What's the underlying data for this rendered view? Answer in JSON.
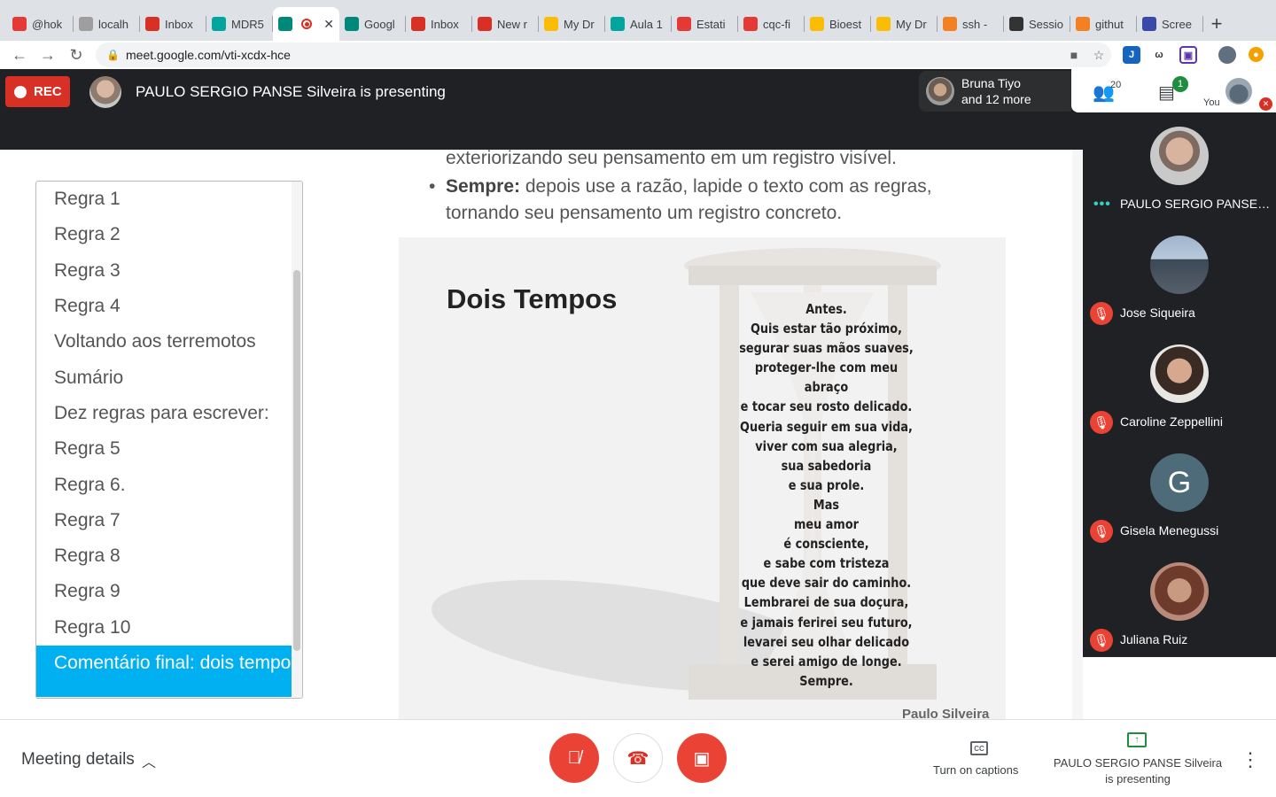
{
  "browser": {
    "tabs": [
      {
        "label": "@hok",
        "icon": "red-square-icon",
        "color": "#e53935",
        "active": false
      },
      {
        "label": "localh",
        "icon": "globe-icon",
        "color": "#9e9e9e",
        "active": false
      },
      {
        "label": "Inbox",
        "icon": "gmail-icon",
        "color": "#d93025",
        "active": false
      },
      {
        "label": "MDR5",
        "icon": "classroom-icon",
        "color": "#00a5a0",
        "active": false
      },
      {
        "label": "",
        "icon": "meet-icon",
        "color": "#00897b",
        "active": true
      },
      {
        "label": "Googl",
        "icon": "meet-icon",
        "color": "#00897b",
        "active": false
      },
      {
        "label": "Inbox",
        "icon": "gmail-icon",
        "color": "#d93025",
        "active": false
      },
      {
        "label": "New r",
        "icon": "gmail-icon",
        "color": "#d93025",
        "active": false
      },
      {
        "label": "My Dr",
        "icon": "drive-icon",
        "color": "#fbbc04",
        "active": false
      },
      {
        "label": "Aula 1",
        "icon": "classroom-icon",
        "color": "#00a5a0",
        "active": false
      },
      {
        "label": "Estati",
        "icon": "pdf-icon",
        "color": "#e53935",
        "active": false
      },
      {
        "label": "cqc-fi",
        "icon": "clapper-icon",
        "color": "#e53935",
        "active": false
      },
      {
        "label": "Bioest",
        "icon": "drive-icon",
        "color": "#fbbc04",
        "active": false
      },
      {
        "label": "My Dr",
        "icon": "drive-icon",
        "color": "#fbbc04",
        "active": false
      },
      {
        "label": "ssh -",
        "icon": "stack-icon",
        "color": "#f48024",
        "active": false
      },
      {
        "label": "Sessio",
        "icon": "github-icon",
        "color": "#333333",
        "active": false
      },
      {
        "label": "githut",
        "icon": "stack-icon",
        "color": "#f48024",
        "active": false
      },
      {
        "label": "Scree",
        "icon": "screen-icon",
        "color": "#3949ab",
        "active": false
      }
    ],
    "new_tab": "+",
    "url": "meet.google.com/vti-xcdx-hce"
  },
  "meet": {
    "rec_label": "REC",
    "presenting_title": "PAULO SERGIO PANSE Silveira is presenting",
    "attendee_pill": {
      "name": "Bruna Tiyo",
      "more": "and 12 more"
    },
    "people_count": "20",
    "chat_badge": "1",
    "you_label": "You"
  },
  "slide": {
    "outline": [
      "Regra 1",
      "Regra 2",
      "Regra 3",
      "Regra 4",
      "Voltando aos terremotos",
      "Sumário",
      "Dez regras para escrever:",
      "Regra 5",
      "Regra 6.",
      "Regra 7",
      "Regra 8",
      "Regra 9",
      "Regra 10"
    ],
    "outline_selected": "Comentário final: dois tempos",
    "bullet_prev": "exteriorizando seu pensamento em um registro visível.",
    "bullet_bold": "Sempre:",
    "bullet_text": " depois use a razão, lapide o texto com as regras, tornando seu pensamento um registro concreto.",
    "poem_title": "Dois Tempos",
    "poem_lines": [
      "Antes.",
      "Quis estar tão próximo,",
      "segurar suas mãos suaves,",
      "proteger-lhe com meu abraço",
      "e tocar seu rosto delicado.",
      "Queria seguir em sua vida,",
      "viver com sua alegria,",
      "sua sabedoria",
      "e sua prole.",
      "Mas",
      "meu amor",
      "é consciente,",
      "e sabe com tristeza",
      "que deve sair do caminho.",
      "Lembrarei de sua doçura,",
      "e jamais ferirei seu futuro,",
      "levarei seu olhar delicado",
      "e serei amigo de longe.",
      "Sempre."
    ],
    "poem_author": "Paulo Silveira"
  },
  "participants": [
    {
      "name": "PAULO SERGIO PANSE Sil...",
      "status": "talking",
      "avatar": "photo"
    },
    {
      "name": "Jose Siqueira",
      "status": "muted",
      "avatar": "photo"
    },
    {
      "name": "Caroline Zeppellini",
      "status": "muted",
      "avatar": "photo"
    },
    {
      "name": "Gisela Menegussi",
      "status": "muted",
      "avatar": "letter",
      "letter": "G"
    },
    {
      "name": "Juliana Ruiz",
      "status": "muted",
      "avatar": "photo"
    }
  ],
  "bottom": {
    "meeting_details": "Meeting details",
    "captions_label": "Turn on captions",
    "present_label": "PAULO SERGIO PANSE Silveira is presenting"
  },
  "colors": {
    "accent_red": "#ea4335",
    "selection_blue": "#00b0f0",
    "meet_dark": "#202124"
  }
}
